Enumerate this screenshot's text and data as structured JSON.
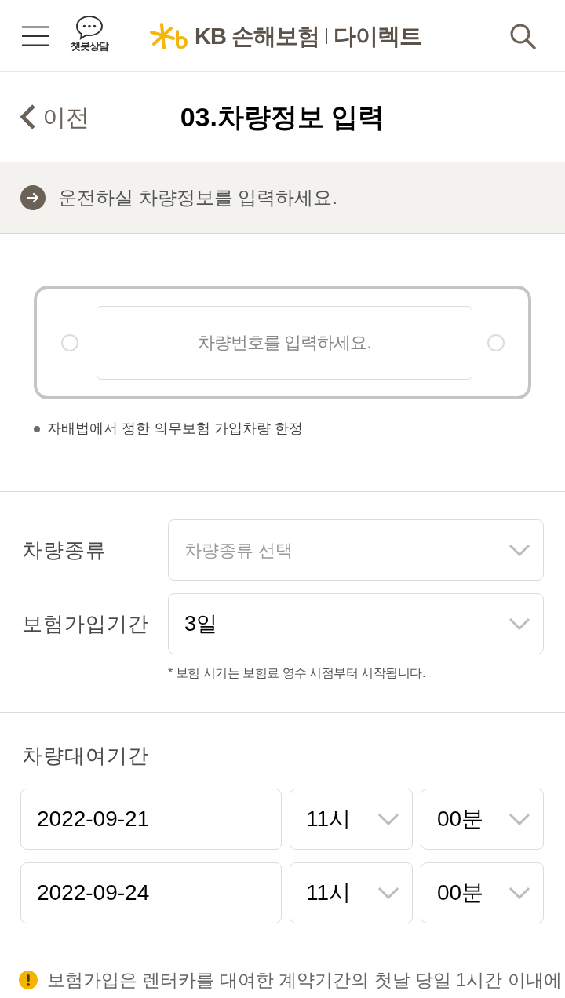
{
  "header": {
    "chatbot_label": "챗봇상담",
    "logo": {
      "brand": "KB 손해보험",
      "service": "다이렉트"
    }
  },
  "page_header": {
    "back_label": "이전",
    "title": "03.차량정보 입력"
  },
  "notice": "운전하실 차량정보를 입력하세요.",
  "vehicle_number": {
    "placeholder": "차량번호를 입력하세요.",
    "note": "자배법에서 정한 의무보험 가입차량 한정"
  },
  "fields": [
    {
      "label": "차량종류",
      "placeholder": "차량종류 선택"
    },
    {
      "label": "보험가입기간",
      "value": "3일"
    }
  ],
  "fields_note": "* 보험 시기는 보험료 영수 시점부터 시작됩니다.",
  "rental_period": {
    "label": "차량대여기간",
    "rows": [
      {
        "date": "2022-09-21",
        "hour": "11시",
        "minute": "00분"
      },
      {
        "date": "2022-09-24",
        "hour": "11시",
        "minute": "00분"
      }
    ]
  },
  "warning": "보험가입은 렌터카를 대여한 계약기간의 첫날 당일 1시간 이내에"
}
